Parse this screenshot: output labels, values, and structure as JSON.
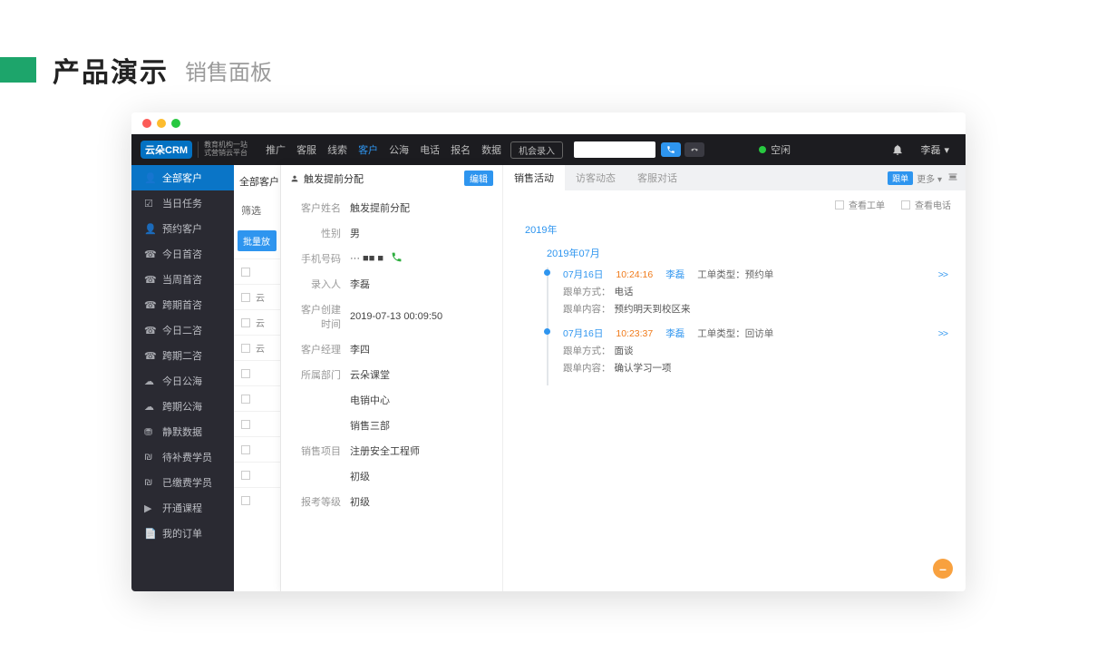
{
  "page": {
    "title": "产品演示",
    "subtitle": "销售面板"
  },
  "topbar": {
    "logo": "云朵CRM",
    "logo_sub1": "教育机构一站",
    "logo_sub2": "式营销云平台",
    "nav": [
      "推广",
      "客服",
      "线索",
      "客户",
      "公海",
      "电话",
      "报名",
      "数据"
    ],
    "nav_active": "客户",
    "chip": "机会录入",
    "status": "空闲",
    "user": "李磊"
  },
  "sidebar": {
    "items": [
      {
        "icon": "👤",
        "label": "全部客户",
        "active": true
      },
      {
        "icon": "☑",
        "label": "当日任务"
      },
      {
        "icon": "👤",
        "label": "预约客户"
      },
      {
        "icon": "☎",
        "label": "今日首咨"
      },
      {
        "icon": "☎",
        "label": "当周首咨"
      },
      {
        "icon": "☎",
        "label": "跨期首咨"
      },
      {
        "icon": "☎",
        "label": "今日二咨"
      },
      {
        "icon": "☎",
        "label": "跨期二咨"
      },
      {
        "icon": "☁",
        "label": "今日公海"
      },
      {
        "icon": "☁",
        "label": "跨期公海"
      },
      {
        "icon": "⛃",
        "label": "静默数据"
      },
      {
        "icon": "₪",
        "label": "待补费学员"
      },
      {
        "icon": "₪",
        "label": "已缴费学员"
      },
      {
        "icon": "▶",
        "label": "开通课程"
      },
      {
        "icon": "📄",
        "label": "我的订单"
      }
    ]
  },
  "mid": {
    "header": "全部客户",
    "filter": "筛选",
    "chip": "批量放",
    "rows": [
      "",
      "云",
      "云",
      "云",
      "",
      "",
      "",
      "",
      "",
      ""
    ]
  },
  "detail": {
    "title": "触发提前分配",
    "edit_btn": "编辑",
    "fields": [
      {
        "k": "客户姓名",
        "v": "触发提前分配"
      },
      {
        "k": "性别",
        "v": "男"
      },
      {
        "k": "手机号码",
        "v": "··· ■■ ■",
        "phone": true
      },
      {
        "k": "录入人",
        "v": "李磊"
      },
      {
        "k": "客户创建时间",
        "v": "2019-07-13 00:09:50"
      },
      {
        "k": "客户经理",
        "v": "李四"
      },
      {
        "k": "所属部门",
        "v": "云朵课堂"
      },
      {
        "k": "",
        "v": "电销中心"
      },
      {
        "k": "",
        "v": "销售三部"
      },
      {
        "k": "销售项目",
        "v": "注册安全工程师"
      },
      {
        "k": "",
        "v": "初级"
      },
      {
        "k": "报考等级",
        "v": "初级"
      }
    ]
  },
  "activity": {
    "tabs": [
      "销售活动",
      "访客动态",
      "客服对话"
    ],
    "active_tab": "销售活动",
    "pill": "跟单",
    "more": "更多 ▾",
    "checks": [
      "查看工单",
      "查看电话"
    ],
    "year": "2019年",
    "month": "2019年07月",
    "entries": [
      {
        "date": "07月16日",
        "time": "10:24:16",
        "name": "李磊",
        "type": "工单类型：预约单",
        "lines": [
          {
            "k": "跟单方式：",
            "v": "电话"
          },
          {
            "k": "跟单内容：",
            "v": "预约明天到校区来"
          }
        ]
      },
      {
        "date": "07月16日",
        "time": "10:23:37",
        "name": "李磊",
        "type": "工单类型：回访单",
        "lines": [
          {
            "k": "跟单方式：",
            "v": "面谈"
          },
          {
            "k": "跟单内容：",
            "v": "确认学习一项"
          }
        ]
      }
    ]
  }
}
